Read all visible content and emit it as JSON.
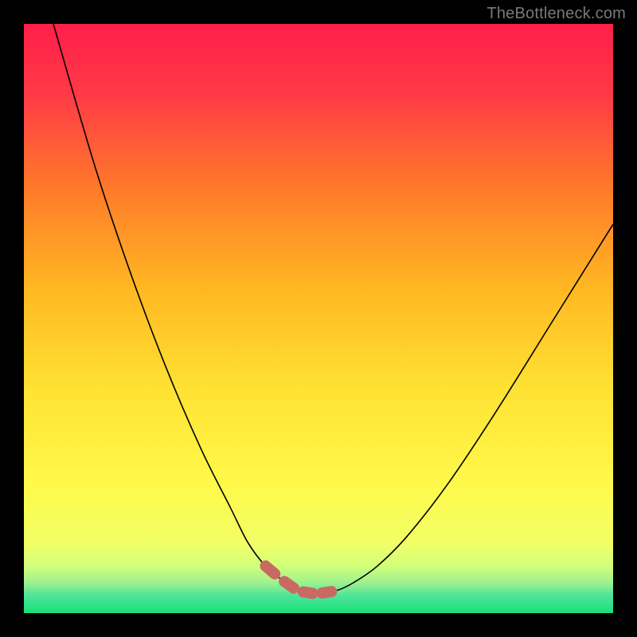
{
  "watermark": {
    "text": "TheBottleneck.com"
  },
  "colors": {
    "frame": "#000000",
    "gradient_top": "#ff1f4a",
    "gradient_mid1": "#ff7a2a",
    "gradient_mid2": "#ffe233",
    "gradient_mid3": "#f2ff66",
    "gradient_bottom": "#18e07a",
    "curve": "#000000",
    "dash": "#c96a62",
    "watermark": "#7a7a7a"
  },
  "chart_data": {
    "type": "line",
    "title": "",
    "xlabel": "",
    "ylabel": "",
    "xlim": [
      0,
      100
    ],
    "ylim": [
      0,
      100
    ],
    "grid": false,
    "series": [
      {
        "name": "bottleneck-curve",
        "x": [
          5,
          12,
          18,
          24,
          30,
          35,
          38,
          41,
          44,
          46,
          48,
          50,
          53,
          56,
          60,
          65,
          72,
          80,
          90,
          100
        ],
        "y": [
          100,
          76,
          58,
          42,
          28,
          18,
          12,
          8,
          5.5,
          4.1,
          3.4,
          3.3,
          3.8,
          5.2,
          8,
          13,
          22,
          34,
          50,
          66
        ]
      }
    ],
    "highlight": {
      "name": "optimal-dash",
      "x_range": [
        41,
        55
      ],
      "y_range": [
        3.0,
        8.5
      ]
    },
    "legend": false
  }
}
